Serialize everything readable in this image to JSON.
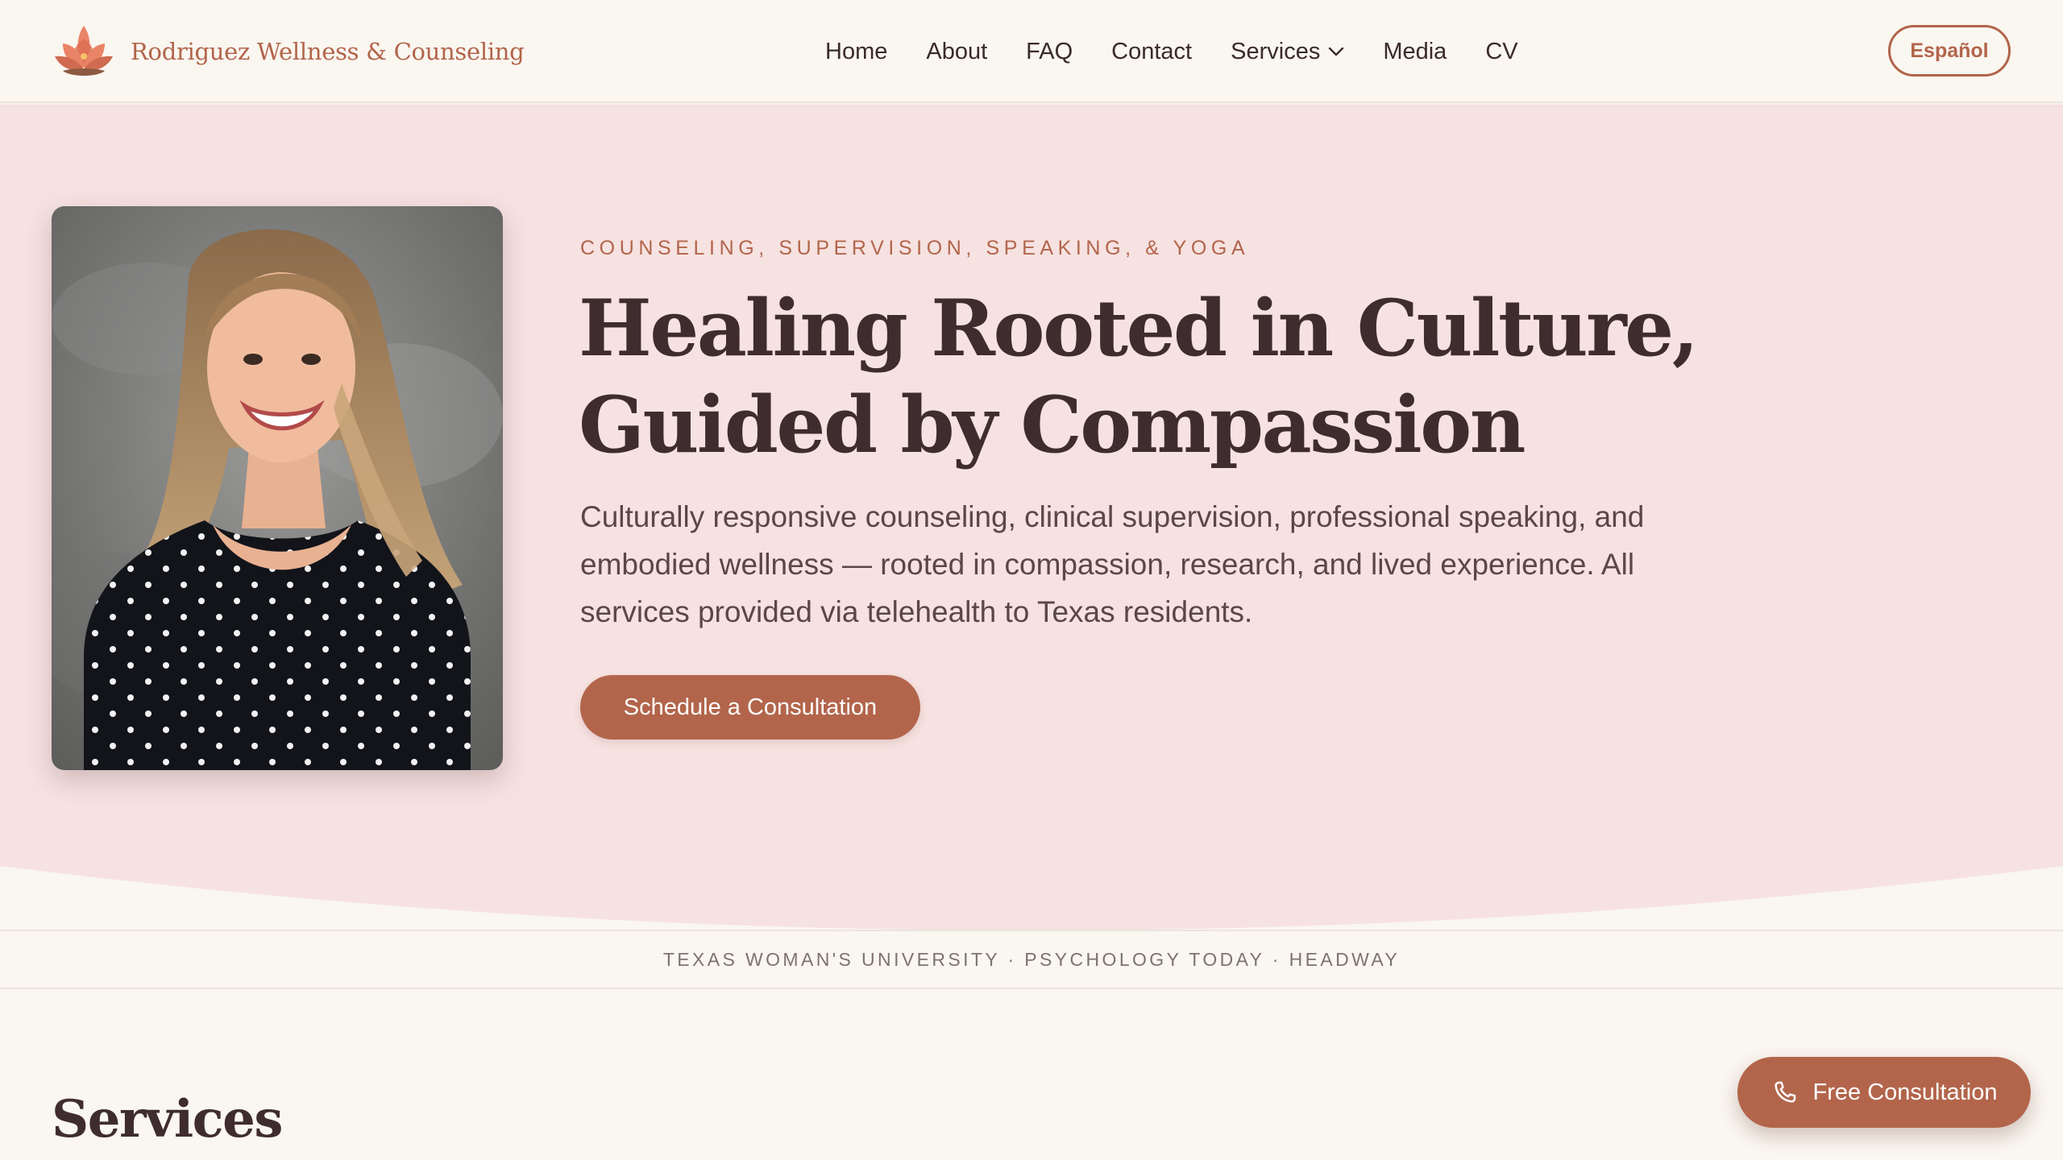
{
  "brand": {
    "name": "Rodriguez Wellness & Counseling",
    "logo_icon": "lotus-icon"
  },
  "nav": {
    "links": [
      "Home",
      "About",
      "FAQ",
      "Contact",
      "Services",
      "Media",
      "CV"
    ],
    "dropdown_icon": "chevron-down-icon",
    "language_button": "Español"
  },
  "hero": {
    "eyebrow": "COUNSELING, SUPERVISION, SPEAKING, & YOGA",
    "headline": "Healing Rooted in Culture, Guided by Compassion",
    "subtext": "Culturally responsive counseling, clinical supervision, professional speaking, and embodied wellness — rooted in compassion, research, and lived experience. All services provided via telehealth to Texas residents.",
    "cta_label": "Schedule a Consultation"
  },
  "trust_bar": {
    "text": "TEXAS WOMAN'S UNIVERSITY · PSYCHOLOGY TODAY · HEADWAY"
  },
  "services": {
    "title": "Services"
  },
  "floating_cta": {
    "label": "Free Consultation",
    "icon": "phone-icon"
  },
  "colors": {
    "accent": "#b2654b",
    "hero_background": "#f6e2e1",
    "page_background": "#faf6f0",
    "heading": "#3f2c2e"
  }
}
